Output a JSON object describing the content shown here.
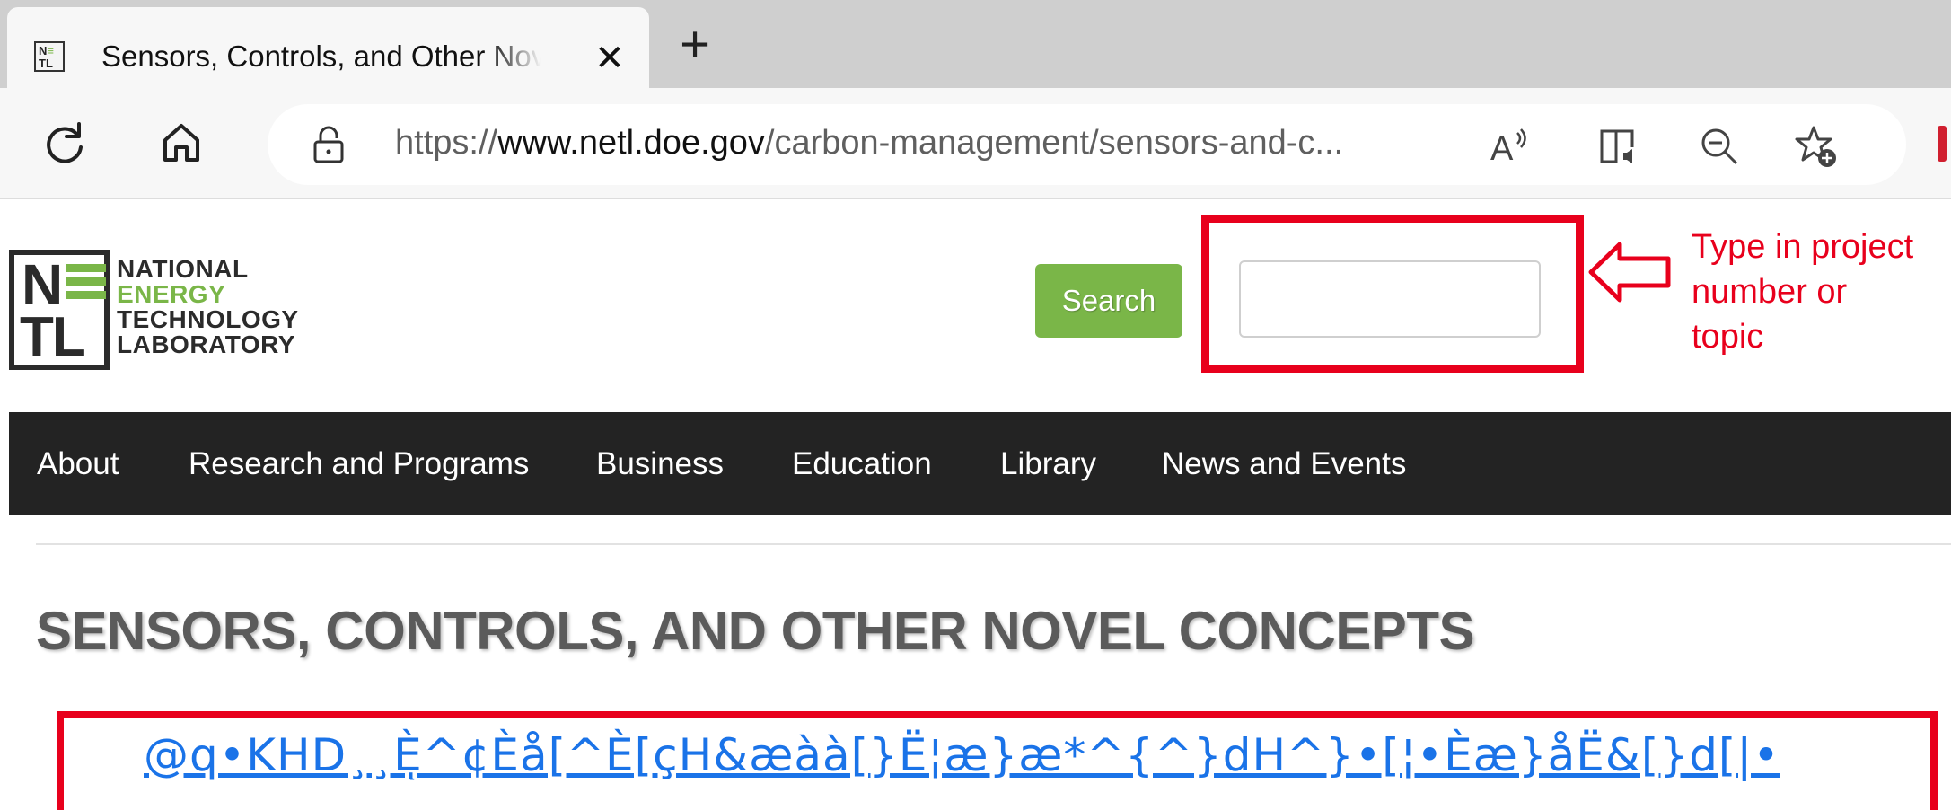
{
  "browser": {
    "tab": {
      "title": "Sensors, Controls, and Other Novel Concepts",
      "favicon": "netl-favicon",
      "close_icon": "close-icon"
    },
    "new_tab_icon": "plus-icon",
    "toolbar": {
      "refresh_icon": "refresh-icon",
      "home_icon": "home-icon",
      "lock_icon": "lock-icon",
      "url_scheme": "https://",
      "url_domain": "www.netl.doe.gov",
      "url_path": "/carbon-management/sensors-and-c...",
      "read_aloud_icon": "read-aloud-icon",
      "immersive_reader_icon": "immersive-reader-icon",
      "zoom_icon": "zoom-out-icon",
      "favorites_icon": "add-favorite-icon"
    }
  },
  "site": {
    "logo": {
      "line1": "NATIONAL",
      "line2": "ENERGY",
      "line3": "TECHNOLOGY",
      "line4": "LABORATORY",
      "mark_top": "N",
      "mark_bottom": "TL"
    },
    "search_button": "Search",
    "search_placeholder": "",
    "nav": [
      "About",
      "Research and Programs",
      "Business",
      "Education",
      "Library",
      "News and Events"
    ],
    "page_title": "SENSORS, CONTROLS, AND OTHER NOVEL CONCEPTS",
    "garbled_link": "@q•KHD¸¸Èͅ^¢Èå[^È[çH&æàà[}Ë¦æ}æ*^{^}dH^}•[¦•Èæ}åË&[}d[|•"
  },
  "annotation": {
    "label": "Type in project number or topic",
    "color": "#e8001c"
  },
  "colors": {
    "accent_green": "#7ab648",
    "nav_background": "#232323",
    "annotation_red": "#e8001c",
    "link_blue": "#1a73e8"
  }
}
